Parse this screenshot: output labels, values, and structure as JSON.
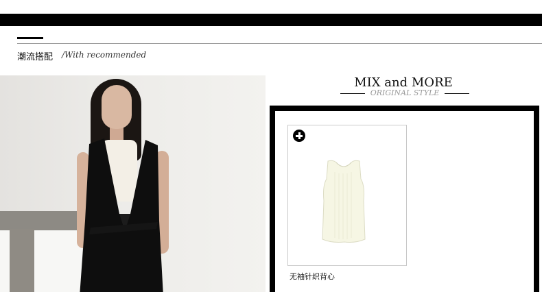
{
  "header": {
    "section_title": "潮流搭配",
    "section_subtitle": "/With recommended"
  },
  "mix": {
    "title": "MIX and MORE",
    "subtitle": "ORIGINAL STYLE"
  },
  "product": {
    "name": "无袖针织背心",
    "icon": "plus-circle-icon"
  },
  "colors": {
    "accent": "#000000",
    "subtitle_gray": "#9a9a9a",
    "card_border": "#c8c8c8"
  }
}
